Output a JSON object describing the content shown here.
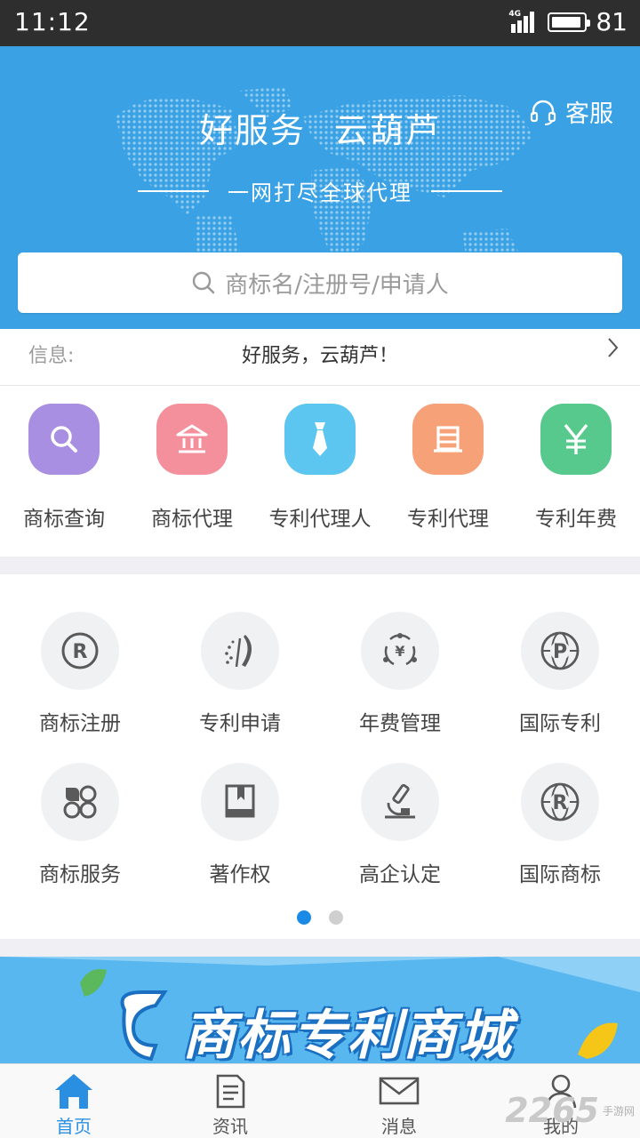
{
  "status_bar": {
    "time": "11:12",
    "network": "4G",
    "battery": "81"
  },
  "hero": {
    "title": "好服务 云葫芦",
    "subtitle": "一网打尽全球代理",
    "service_label": "客服",
    "search_placeholder": "商标名/注册号/申请人"
  },
  "info": {
    "label": "信息:",
    "text": "好服务，云葫芦！"
  },
  "quick_services": [
    {
      "label": "商标查询",
      "icon": "search-icon",
      "color": "#a88fe2"
    },
    {
      "label": "商标代理",
      "icon": "bank-icon",
      "color": "#f48f9c"
    },
    {
      "label": "专利代理人",
      "icon": "tie-icon",
      "color": "#5cc6f0"
    },
    {
      "label": "专利代理",
      "icon": "box-icon",
      "color": "#f6a177"
    },
    {
      "label": "专利年费",
      "icon": "yen-icon",
      "color": "#58c98d"
    }
  ],
  "grid_services": [
    {
      "label": "商标注册",
      "icon": "registered-icon"
    },
    {
      "label": "专利申请",
      "icon": "patent-pen-icon"
    },
    {
      "label": "年费管理",
      "icon": "yen-cycle-icon"
    },
    {
      "label": "国际专利",
      "icon": "globe-p-icon"
    },
    {
      "label": "商标服务",
      "icon": "clover-icon"
    },
    {
      "label": "著作权",
      "icon": "book-icon"
    },
    {
      "label": "高企认定",
      "icon": "microscope-icon"
    },
    {
      "label": "国际商标",
      "icon": "globe-r-icon"
    }
  ],
  "pager": {
    "pages": 2,
    "active": 1
  },
  "banner": {
    "text": "商标专利商城"
  },
  "tabs": [
    {
      "label": "首页",
      "icon": "home-icon",
      "active": true
    },
    {
      "label": "资讯",
      "icon": "news-icon",
      "active": false
    },
    {
      "label": "消息",
      "icon": "mail-icon",
      "active": false
    },
    {
      "label": "我的",
      "icon": "user-icon",
      "active": false
    }
  ],
  "watermark": {
    "number": "2265",
    "site": "手游网"
  },
  "colors": {
    "primary": "#3aa2e4",
    "accent": "#2a8fe0",
    "icon_gray": "#5a5a5a"
  }
}
